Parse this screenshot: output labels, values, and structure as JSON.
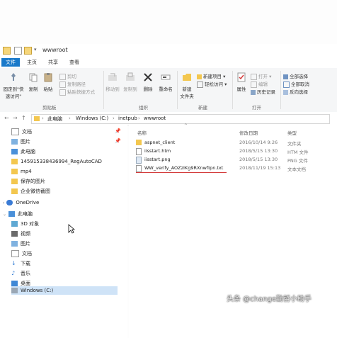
{
  "window": {
    "title": "wwwroot"
  },
  "ribbon_tabs": [
    "文件",
    "主页",
    "共享",
    "查看"
  ],
  "ribbon": {
    "pin_quick_access": [
      "固定到\"快",
      "速访问\""
    ],
    "copy": "复制",
    "paste": "粘贴",
    "cut": "剪切",
    "copy_path": "复制路径",
    "paste_shortcut": "粘贴快捷方式",
    "move_to": "移动到",
    "copy_to": "复制到",
    "delete": "删除",
    "rename": "重命名",
    "new_item": "新建项目",
    "easy_access": "轻松访问",
    "new_folder": [
      "新建",
      "文件夹"
    ],
    "open": "打开",
    "edit": "编辑",
    "history": "历史记录",
    "properties": "属性",
    "select_all": "全部选择",
    "select_none": "全部取消",
    "invert_selection": "反向选择",
    "groups": {
      "clipboard": "剪贴板",
      "organize": "组织",
      "new": "新建",
      "open": "打开"
    }
  },
  "address": {
    "crumbs": [
      "此电脑",
      "Windows (C:)",
      "inetpub",
      "wwwroot"
    ]
  },
  "nav_quick": [
    "文档",
    "图片",
    "此电脑",
    "1459153384369​94_RegAutoCAD",
    "mp4",
    "保存的图片",
    "企业微信截图"
  ],
  "nav_sections": {
    "onedrive": "OneDrive",
    "thispc": "此电脑"
  },
  "nav_pc": [
    "3D 对象",
    "视频",
    "图片",
    "文档",
    "下载",
    "音乐",
    "桌面",
    "Windows (C:)"
  ],
  "columns": {
    "name": "名称",
    "date": "修改日期",
    "type": "类型"
  },
  "files": [
    {
      "name": "aspnet_client",
      "date": "2016/10/14 9:26",
      "type": "文件夹",
      "kind": "folder"
    },
    {
      "name": "iisstart.htm",
      "date": "2018/5/15 13:30",
      "type": "HTM 文件",
      "kind": "htm"
    },
    {
      "name": "iisstart.png",
      "date": "2018/5/15 13:30",
      "type": "PNG 文件",
      "kind": "png"
    },
    {
      "name": "WW_verify_AOZzIKg9RXnwfIpn.txt",
      "date": "2018/11/19 15:13",
      "type": "文本文档",
      "kind": "txt"
    }
  ],
  "watermark": "头条 @change勤哲小助手",
  "colors": {
    "accent": "#1979ca",
    "folder": "#f3c74f",
    "highlight_line": "#d43b3b"
  }
}
